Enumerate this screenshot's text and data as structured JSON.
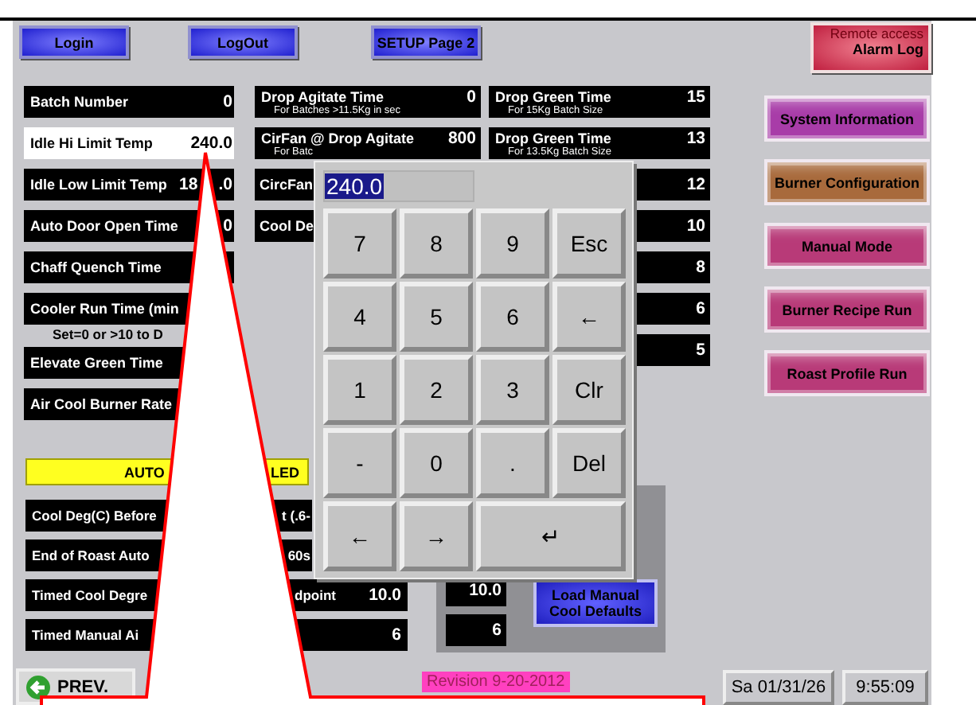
{
  "top_buttons": [
    {
      "label": "Login"
    },
    {
      "label": "LogOut"
    },
    {
      "label": "SETUP Page 2"
    }
  ],
  "alarm_log": {
    "caption": "Remote access",
    "label": "Alarm Log"
  },
  "left_fields": [
    {
      "label": "Batch Number",
      "value": "0",
      "selected": false
    },
    {
      "label": "Idle Hi Limit Temp",
      "value": "240.0",
      "selected": true
    },
    {
      "label": "Idle Low Limit Temp",
      "value": "18",
      "value_end": ".0",
      "selected": false
    },
    {
      "label": "Auto Door Open Time",
      "value": "0",
      "selected": false
    },
    {
      "label": "Chaff Quench Time",
      "selected": false
    },
    {
      "label": "Cooler Run Time (min",
      "note": "Set=0 or >10 to D",
      "selected": false
    },
    {
      "label": "Elevate Green Time",
      "selected": false
    },
    {
      "label": "Air Cool Burner Rate",
      "selected": false
    }
  ],
  "mid_fields": [
    {
      "label": "Drop Agitate Time",
      "note": "For Batches >11.5Kg in sec",
      "value": "0"
    },
    {
      "label": "CirFan @ Drop Agitate",
      "note": "For Batc",
      "value": "800"
    },
    {
      "label": "CircFan"
    },
    {
      "label": "Cool De"
    }
  ],
  "right_fields": [
    {
      "label": "Drop Green Time",
      "note": "For 15Kg Batch Size",
      "value": "15"
    },
    {
      "label": "Drop Green Time",
      "note": "For 13.5Kg Batch Size",
      "value": "13"
    },
    {
      "value": "12"
    },
    {
      "value": "10"
    },
    {
      "value": "8"
    },
    {
      "value": "6"
    },
    {
      "value": "5"
    }
  ],
  "nav_buttons": [
    {
      "label": "System Information",
      "color": "#a83ca8"
    },
    {
      "label": "Burner Configuration",
      "color": "#a86a3c"
    },
    {
      "label": "Manual Mode",
      "color": "#b83a78"
    },
    {
      "label": "Burner Recipe Run",
      "color": "#b83a78"
    },
    {
      "label": "Roast Profile Run",
      "color": "#b83a78"
    }
  ],
  "auto_bar": {
    "left": "AUTO",
    "right": "LED"
  },
  "lower_fields": [
    {
      "label": "Cool Deg(C) Before",
      "label_end": "t (.6-"
    },
    {
      "label": "End of Roast Auto",
      "label_end": "60s"
    },
    {
      "label": "Timed Cool Degre",
      "label_end": "dpoint",
      "value": "10.0"
    },
    {
      "label": "Timed Manual Ai",
      "value": "6"
    }
  ],
  "cool_panel": {
    "fields": [
      "10.0",
      "6"
    ],
    "button": "Load Manual Cool Defaults"
  },
  "footer": {
    "prev": "PREV.",
    "revision": "Revision 9-20-2012",
    "date": "Sa 01/31/26",
    "time": "9:55:09"
  },
  "keypad": {
    "display": "240.0",
    "keys": [
      {
        "label": "7",
        "wide": false
      },
      {
        "label": "8",
        "wide": false
      },
      {
        "label": "9",
        "wide": false
      },
      {
        "label": "Esc",
        "wide": false
      },
      {
        "label": "4",
        "wide": false
      },
      {
        "label": "5",
        "wide": false
      },
      {
        "label": "6",
        "wide": false
      },
      {
        "label": "←",
        "wide": false
      },
      {
        "label": "1",
        "wide": false
      },
      {
        "label": "2",
        "wide": false
      },
      {
        "label": "3",
        "wide": false
      },
      {
        "label": "Clr",
        "wide": false
      },
      {
        "label": "-",
        "wide": false
      },
      {
        "label": "0",
        "wide": false
      },
      {
        "label": ".",
        "wide": false
      },
      {
        "label": "Del",
        "wide": false
      },
      {
        "label": "←",
        "wide": false
      },
      {
        "label": "→",
        "wide": false
      },
      {
        "label": "↵",
        "wide": true
      }
    ]
  }
}
